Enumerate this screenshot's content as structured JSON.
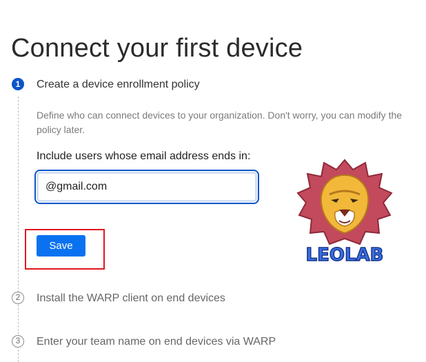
{
  "page": {
    "title": "Connect your first device"
  },
  "steps": [
    {
      "number": "1",
      "label": "Create a device enrollment policy",
      "state": "active"
    },
    {
      "number": "2",
      "label": "Install the WARP client on end devices",
      "state": "inactive"
    },
    {
      "number": "3",
      "label": "Enter your team name on end devices via WARP",
      "state": "inactive"
    }
  ],
  "step1": {
    "description": "Define who can connect devices to your organization. Don't worry, you can modify the policy later.",
    "field_label": "Include users whose email address ends in:",
    "email_value": "@gmail.com",
    "save_label": "Save"
  },
  "watermark": {
    "text": "LEOLAB",
    "icon": "lion-head-logo"
  },
  "colors": {
    "accent": "#0a55c8",
    "button": "#0a72f0",
    "highlight": "#e0161f"
  }
}
